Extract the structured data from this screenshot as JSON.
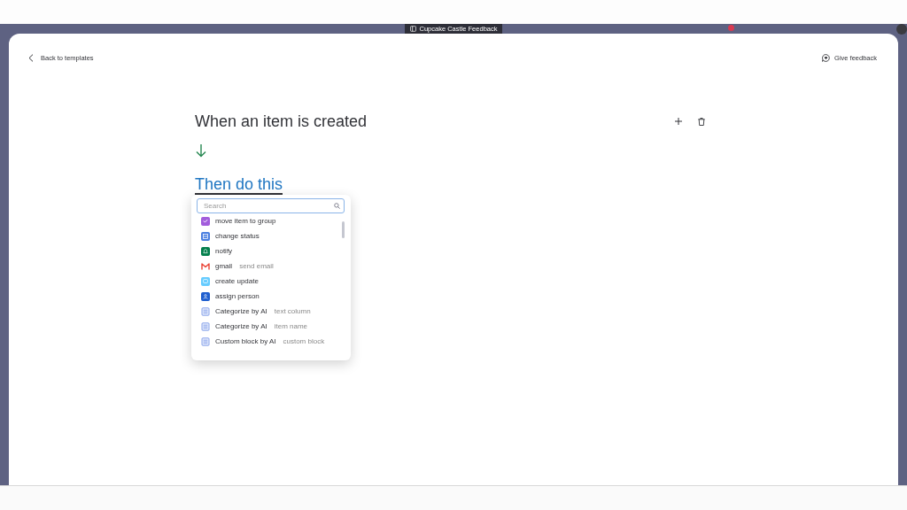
{
  "window": {
    "title": "Cupcake Castle Feedback"
  },
  "header": {
    "back_link": "Back to templates",
    "feedback_link": "Give feedback"
  },
  "trigger": {
    "text": "When an item is created"
  },
  "action": {
    "heading": "Then do this",
    "menu": {
      "search": {
        "placeholder": "Search"
      },
      "items": [
        {
          "label": "move item to group",
          "kind": "group",
          "color": "#a25ddc"
        },
        {
          "label": "change status",
          "kind": "status",
          "color": "#4a7fe0"
        },
        {
          "label": "notify",
          "kind": "notify",
          "color": "#037f4c"
        },
        {
          "label": "gmail",
          "detail": "send email",
          "kind": "gmail"
        },
        {
          "label": "create update",
          "kind": "update",
          "color": "#66ccff"
        },
        {
          "label": "assign person",
          "kind": "person",
          "color": "#1f5fcf"
        },
        {
          "label": "Categorize by AI",
          "detail": "text column",
          "kind": "ai"
        },
        {
          "label": "Categorize by AI",
          "detail": "item name",
          "kind": "ai"
        },
        {
          "label": "Custom block by AI",
          "detail": "custom block",
          "kind": "ai"
        }
      ]
    }
  }
}
